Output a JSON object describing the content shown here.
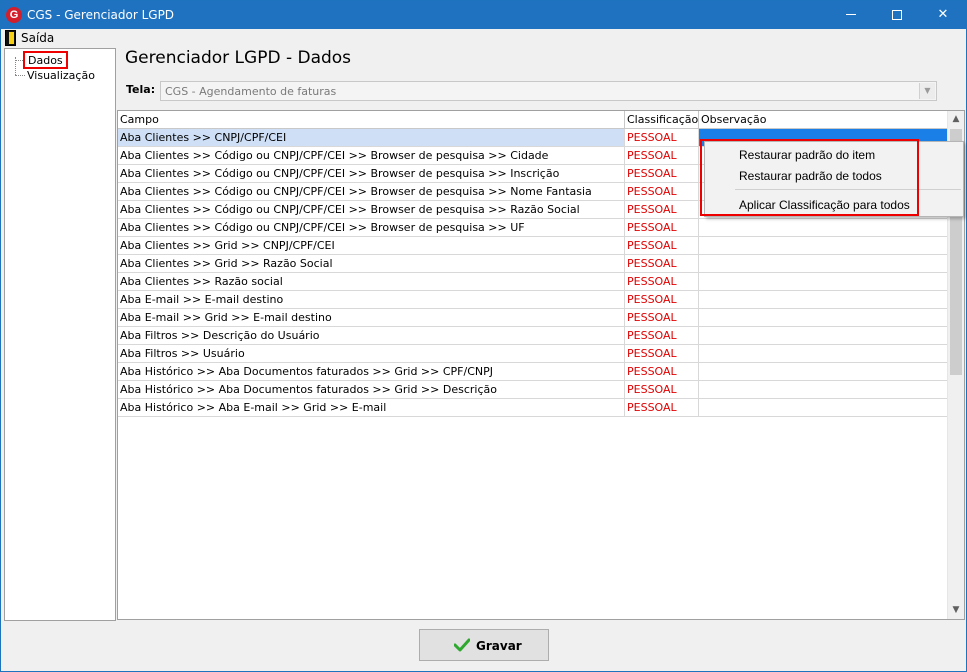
{
  "window": {
    "title": "CGS - Gerenciador LGPD",
    "icon_glyph": "G",
    "minimize_icon": "minimize-icon",
    "maximize_icon": "maximize-icon",
    "close_glyph": "✕"
  },
  "menubar": {
    "exit_label": "Saída"
  },
  "tree": {
    "items": [
      {
        "label": "Dados",
        "selected": true
      },
      {
        "label": "Visualização",
        "selected": false
      }
    ]
  },
  "main": {
    "heading": "Gerenciador LGPD - Dados",
    "tela_label": "Tela:",
    "tela_value": "CGS - Agendamento de faturas",
    "dropdown_glyph": "▼"
  },
  "grid": {
    "headers": [
      "Campo",
      "Classificação",
      "Observação"
    ],
    "rows": [
      [
        "Aba Clientes >> CNPJ/CPF/CEI",
        "PESSOAL",
        ""
      ],
      [
        "Aba Clientes >> Código ou CNPJ/CPF/CEI >> Browser de pesquisa >> Cidade",
        "PESSOAL",
        ""
      ],
      [
        "Aba Clientes >> Código ou CNPJ/CPF/CEI >> Browser de pesquisa >> Inscrição",
        "PESSOAL",
        ""
      ],
      [
        "Aba Clientes >> Código ou CNPJ/CPF/CEI >> Browser de pesquisa >> Nome Fantasia",
        "PESSOAL",
        ""
      ],
      [
        "Aba Clientes >> Código ou CNPJ/CPF/CEI >> Browser de pesquisa >> Razão Social",
        "PESSOAL",
        ""
      ],
      [
        "Aba Clientes >> Código ou CNPJ/CPF/CEI >> Browser de pesquisa >> UF",
        "PESSOAL",
        ""
      ],
      [
        "Aba Clientes >> Grid >> CNPJ/CPF/CEI",
        "PESSOAL",
        ""
      ],
      [
        "Aba Clientes >> Grid >> Razão Social",
        "PESSOAL",
        ""
      ],
      [
        "Aba Clientes >> Razão social",
        "PESSOAL",
        ""
      ],
      [
        "Aba E-mail >> E-mail destino",
        "PESSOAL",
        ""
      ],
      [
        "Aba E-mail >> Grid >> E-mail destino",
        "PESSOAL",
        ""
      ],
      [
        "Aba Filtros >> Descrição do Usuário",
        "PESSOAL",
        ""
      ],
      [
        "Aba Filtros >> Usuário",
        "PESSOAL",
        ""
      ],
      [
        "Aba Histórico >> Aba Documentos faturados >> Grid >> CPF/CNPJ",
        "PESSOAL",
        ""
      ],
      [
        "Aba Histórico >> Aba Documentos faturados >> Grid >> Descrição",
        "PESSOAL",
        ""
      ],
      [
        "Aba Histórico >> Aba E-mail >> Grid >> E-mail",
        "PESSOAL",
        ""
      ]
    ],
    "scroll_up_glyph": "▲",
    "scroll_down_glyph": "▼"
  },
  "context_menu": {
    "items": [
      "Restaurar padrão do item",
      "Restaurar padrão de todos",
      "Aplicar Classificação para todos"
    ]
  },
  "footer": {
    "save_label": "Gravar"
  },
  "colors": {
    "titlebar": "#1f72c0",
    "classification_text": "#e00000",
    "highlight_border": "#ee0000",
    "selected_cell": "#1a7fe6"
  }
}
